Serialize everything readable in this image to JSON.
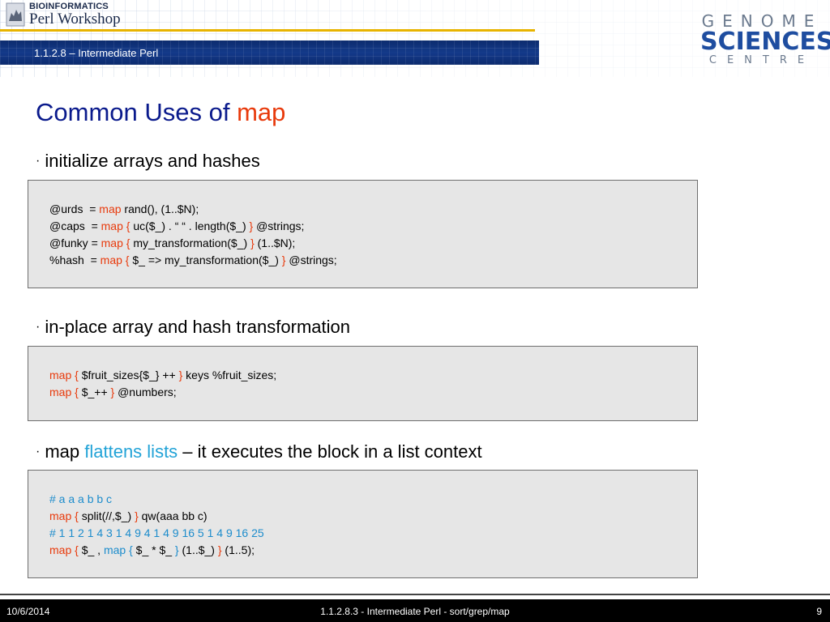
{
  "header": {
    "logo_top": "BIOINFORMATICS",
    "logo_bottom": "Perl Workshop",
    "banner": "1.1.2.8 – Intermediate Perl",
    "gsc_line1": "GENOME",
    "gsc_line2": "SCIENCES",
    "gsc_line3": "CENTRE"
  },
  "slide": {
    "title_prefix": "Common Uses of ",
    "title_keyword": "map"
  },
  "bullets": [
    {
      "text": "initialize arrays and hashes"
    },
    {
      "text": "in-place array and hash transformation"
    },
    {
      "prefix": "map ",
      "highlight": "flattens lists",
      "suffix": " – it executes the block in a list context"
    }
  ],
  "bullet_marker": "·",
  "code1": {
    "l1a": "@urds  = ",
    "l1b": "map",
    "l1c": " rand(), (1..$N);",
    "l2a": "@caps  = ",
    "l2b": "map {",
    "l2c": " uc($_) . “ “ . length($_) ",
    "l2d": "}",
    "l2e": " @strings;",
    "l3a": "@funky = ",
    "l3b": "map {",
    "l3c": " my_transformation($_) ",
    "l3d": "}",
    "l3e": " (1..$N);",
    "l4a": "%hash  = ",
    "l4b": "map {",
    "l4c": " $_ => my_transformation($_) ",
    "l4d": "}",
    "l4e": " @strings;"
  },
  "code2": {
    "l1a": "map {",
    "l1b": " $fruit_sizes{$_} ++ ",
    "l1c": "}",
    "l1d": " keys %fruit_sizes;",
    "l2a": "map {",
    "l2b": " $_++ ",
    "l2c": "}",
    "l2d": " @numbers;"
  },
  "code3": {
    "c1": "# a a a b b c",
    "l2a": "map {",
    "l2b": " split(//,$_) ",
    "l2c": "}",
    "l2d": " qw(aaa bb c)",
    "c3": "# 1 1 2 1 4 3 1 4 9 4 1 4 9 16 5 1 4 9 16 25",
    "l4a": "map {",
    "l4b": " $_ , ",
    "l4c": "map {",
    "l4d": " $_ * $_ ",
    "l4e": "}",
    "l4f": " (1..$_) ",
    "l4g": "}",
    "l4h": " (1..5);"
  },
  "footer": {
    "date": "10/6/2014",
    "center": "1.1.2.8.3 - Intermediate Perl - sort/grep/map",
    "page": "9"
  },
  "colors": {
    "title": "#0a1a8c",
    "keyword": "#e83a0c",
    "comment": "#1c8ccc",
    "highlight": "#22a3d7",
    "banner": "#0c2b6e",
    "accent_line": "#e8b400"
  }
}
